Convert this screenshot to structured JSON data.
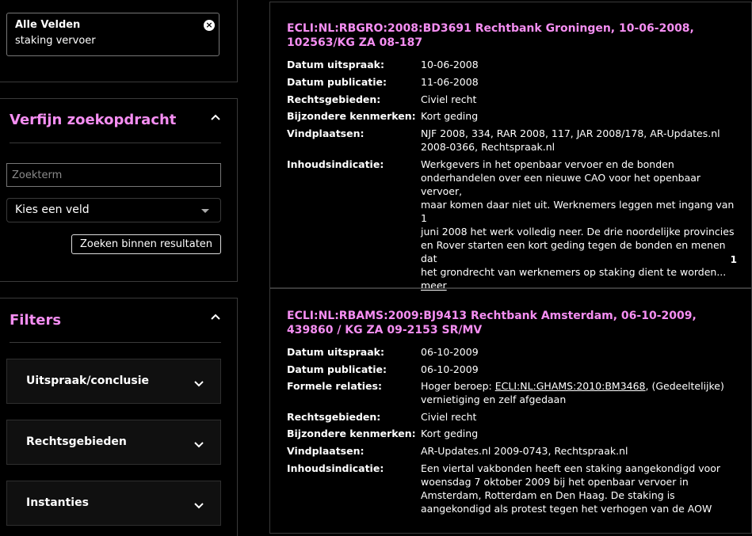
{
  "search_chip": {
    "label": "Alle Velden",
    "value": "staking vervoer",
    "close": "×"
  },
  "refine": {
    "title": "Verfijn zoekopdracht",
    "input_placeholder": "Zoekterm",
    "select_value": "Kies een veld",
    "button_label": "Zoeken binnen resultaten"
  },
  "filters": {
    "title": "Filters",
    "facets": [
      "Uitspraak/conclusie",
      "Rechtsgebieden",
      "Instanties"
    ]
  },
  "results": [
    {
      "title_line1": "ECLI:NL:RBGRO:2008:BD3691 Rechtbank Groningen, 10-06-2008,",
      "title_line2": "102563/KG ZA 08-187",
      "fields": {
        "datum_uitspraak": {
          "label": "Datum uitspraak:",
          "value": "10-06-2008"
        },
        "datum_publicatie": {
          "label": "Datum publicatie:",
          "value": "11-06-2008"
        },
        "rechtsgebieden": {
          "label": "Rechtsgebieden:",
          "value": "Civiel recht"
        },
        "kenmerken": {
          "label": "Bijzondere kenmerken:",
          "value": "Kort geding"
        },
        "vindplaatsen": {
          "label": "Vindplaatsen:",
          "line1": "NJF 2008, 334, RAR 2008, 117, JAR 2008/178, AR-Updates.nl",
          "line2": "2008-0366, Rechtspraak.nl"
        },
        "inhoud": {
          "label": "Inhoudsindicatie:",
          "lines": [
            "Werkgevers in het openbaar vervoer en de bonden",
            "onderhandelen over een nieuwe CAO voor het openbaar vervoer,",
            "maar komen daar niet uit. Werknemers leggen met ingang van 1",
            "juni 2008 het werk volledig neer. De drie noordelijke provincies",
            "en Rover starten een kort geding tegen de bonden en menen dat",
            "het grondrecht van werknemers op staking dient te worden..."
          ],
          "more": "meer"
        }
      },
      "page_number": "1"
    },
    {
      "title_line1": "ECLI:NL:RBAMS:2009:BJ9413 Rechtbank Amsterdam, 06-10-2009,",
      "title_line2": "439860 / KG ZA 09-2153 SR/MV",
      "fields": {
        "datum_uitspraak": {
          "label": "Datum uitspraak:",
          "value": "06-10-2009"
        },
        "datum_publicatie": {
          "label": "Datum publicatie:",
          "value": "06-10-2009"
        },
        "formele_relaties": {
          "label": "Formele relaties:",
          "prefix": "Hoger beroep: ",
          "link": "ECLI:NL:GHAMS:2010:BM3468",
          "suffix": ", (Gedeeltelijke)",
          "line2": "vernietiging en zelf afgedaan"
        },
        "rechtsgebieden": {
          "label": "Rechtsgebieden:",
          "value": "Civiel recht"
        },
        "kenmerken": {
          "label": "Bijzondere kenmerken:",
          "value": "Kort geding"
        },
        "vindplaatsen": {
          "label": "Vindplaatsen:",
          "value": "AR-Updates.nl 2009-0743, Rechtspraak.nl"
        },
        "inhoud": {
          "label": "Inhoudsindicatie:",
          "lines": [
            "Een viertal vakbonden heeft een staking aangekondigd voor",
            "woensdag 7 oktober 2009 bij het openbaar vervoer in",
            "Amsterdam, Rotterdam en Den Haag. De staking is",
            "aangekondigd als protest tegen het verhogen van de AOW"
          ]
        }
      }
    }
  ]
}
